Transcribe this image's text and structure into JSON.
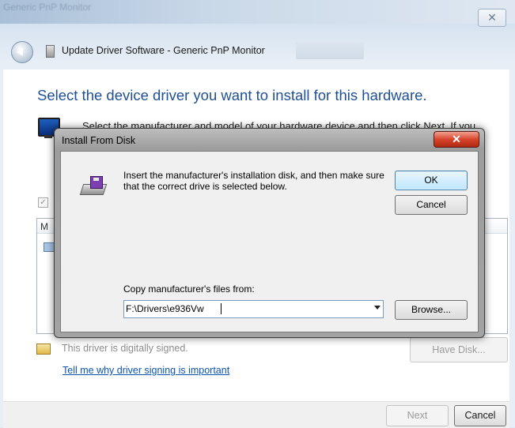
{
  "wizard": {
    "blurred_title": "Generic PnP Monitor",
    "title": "Update Driver Software - Generic PnP Monitor",
    "heading": "Select the device driver you want to install for this hardware.",
    "instruction": "Select the manufacturer and model of your hardware device and then click Next. If you",
    "list_header": "M",
    "signed_text": "This driver is digitally signed.",
    "why_link": "Tell me why driver signing is important",
    "have_disk_label": "Have Disk...",
    "next_label": "Next",
    "cancel_label": "Cancel",
    "close_glyph": "✕"
  },
  "dialog": {
    "title": "Install From Disk",
    "close_glyph": "✕",
    "message": "Insert the manufacturer's installation disk, and then make sure that the correct drive is selected below.",
    "ok_label": "OK",
    "cancel_label": "Cancel",
    "copy_label": "Copy manufacturer's files from:",
    "path_value": "F:\\Drivers\\e936Vw",
    "browse_label": "Browse..."
  }
}
